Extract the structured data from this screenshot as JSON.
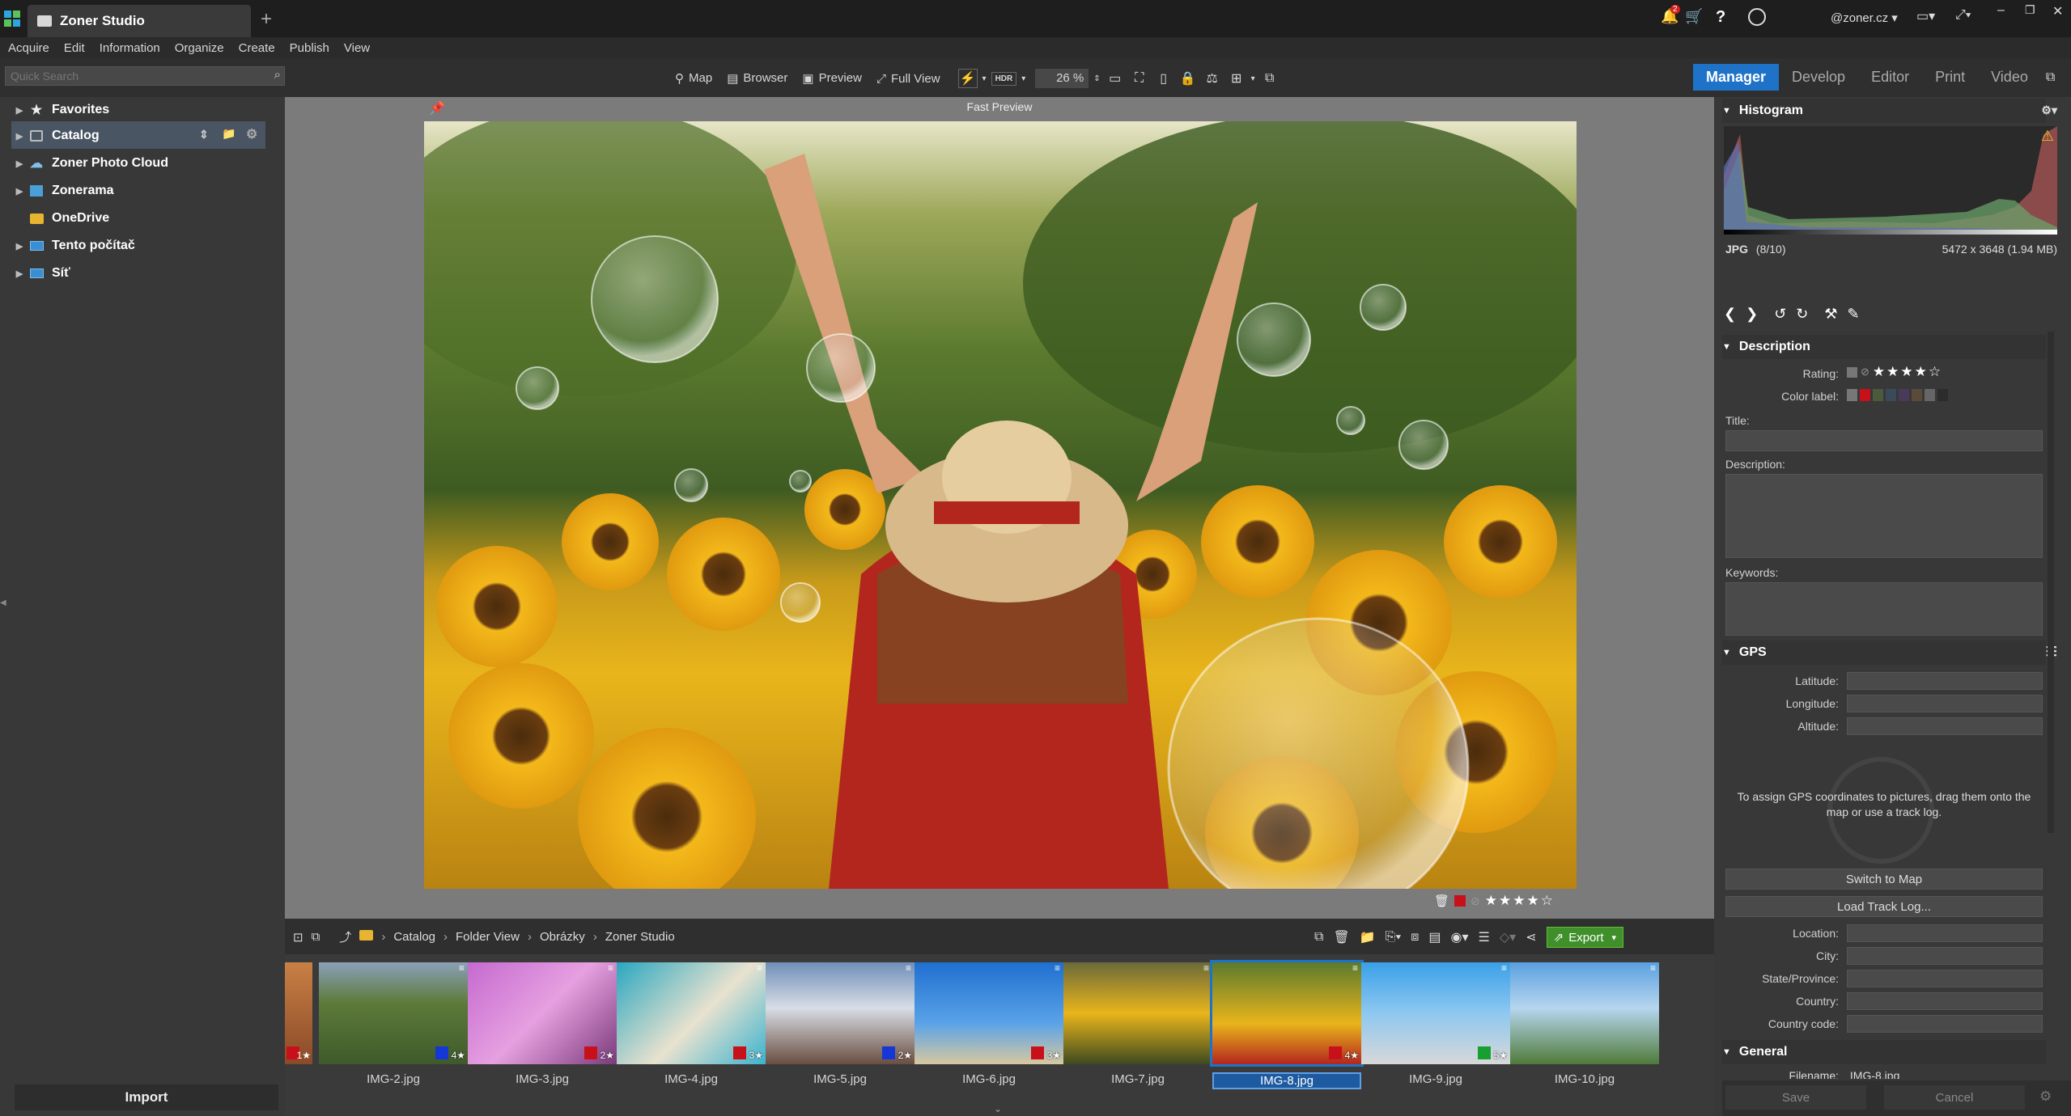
{
  "app": {
    "tab_title": "Zoner Studio",
    "new_tab": "+",
    "account": "@zoner.cz",
    "notif_count": "2"
  },
  "menu": [
    "Acquire",
    "Edit",
    "Information",
    "Organize",
    "Create",
    "Publish",
    "View"
  ],
  "search": {
    "placeholder": "Quick Search"
  },
  "toolbar": {
    "map": "Map",
    "browser": "Browser",
    "preview": "Preview",
    "full_view": "Full View",
    "hdr": "HDR",
    "zoom": "26 %"
  },
  "modes": [
    "Manager",
    "Develop",
    "Editor",
    "Print",
    "Video"
  ],
  "nav_tree": [
    {
      "label": "Favorites",
      "icon": "star-icon"
    },
    {
      "label": "Catalog",
      "icon": "catalog-icon"
    },
    {
      "label": "Zoner Photo Cloud",
      "icon": "cloud-icon"
    },
    {
      "label": "Zonerama",
      "icon": "zonerama-icon"
    },
    {
      "label": "OneDrive",
      "icon": "folder-icon"
    },
    {
      "label": "Tento počítač",
      "icon": "computer-icon"
    },
    {
      "label": "Síť",
      "icon": "network-icon"
    }
  ],
  "import_label": "Import",
  "preview": {
    "header": "Fast Preview",
    "rating": 4
  },
  "breadcrumb": [
    "Catalog",
    "Folder View",
    "Obrázky",
    "Zoner Studio"
  ],
  "export_label": "Export",
  "thumbs": [
    {
      "name": "IMG-2.jpg",
      "rating": "4★",
      "color": "#1537d6"
    },
    {
      "name": "IMG-3.jpg",
      "rating": "2★",
      "color": "#c8101a"
    },
    {
      "name": "IMG-4.jpg",
      "rating": "3★",
      "color": "#c8101a"
    },
    {
      "name": "IMG-5.jpg",
      "rating": "2★",
      "color": "#1537d6"
    },
    {
      "name": "IMG-6.jpg",
      "rating": "3★",
      "color": "#c8101a"
    },
    {
      "name": "IMG-7.jpg",
      "rating": "",
      "color": ""
    },
    {
      "name": "IMG-8.jpg",
      "rating": "4★",
      "color": "#c8101a"
    },
    {
      "name": "IMG-9.jpg",
      "rating": "5★",
      "color": "#16a030"
    },
    {
      "name": "IMG-10.jpg",
      "rating": "",
      "color": ""
    }
  ],
  "partial_thumb_rating": "1★",
  "histogram": {
    "title": "Histogram",
    "format": "JPG",
    "index": "(8/10)",
    "dims": "5472 x 3648 (1.94 MB)"
  },
  "description": {
    "title": "Description",
    "rating_label": "Rating:",
    "rating": 4,
    "color_label": "Color label:",
    "title_label": "Title:",
    "desc_label": "Description:",
    "keywords_label": "Keywords:"
  },
  "gps": {
    "title": "GPS",
    "latitude": "Latitude:",
    "longitude": "Longitude:",
    "altitude": "Altitude:",
    "hint": "To assign GPS coordinates to pictures, drag them onto the map or use a track log.",
    "switch_map": "Switch to Map",
    "load_track": "Load Track Log...",
    "location": "Location:",
    "city": "City:",
    "state": "State/Province:",
    "country": "Country:",
    "country_code": "Country code:"
  },
  "general": {
    "title": "General",
    "filename_label": "Filename:",
    "filename": "IMG-8.jpg"
  },
  "footer": {
    "save": "Save",
    "cancel": "Cancel"
  },
  "colors": {
    "accent": "#1e73c8",
    "export_green": "#3f8f2a"
  }
}
